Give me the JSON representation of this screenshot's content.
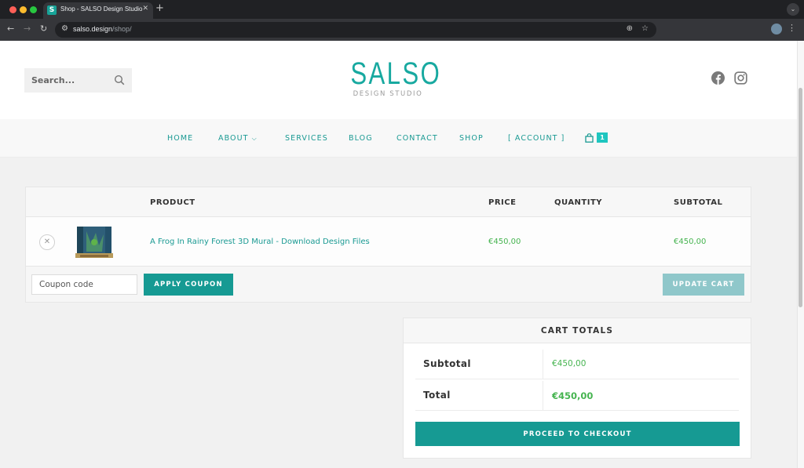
{
  "browser": {
    "tab_title": "Shop - SALSO Design Studio",
    "tab_favicon_letter": "S",
    "url_host": "salso.design",
    "url_path": "/shop/",
    "url": "salso.design/shop/"
  },
  "header": {
    "search_placeholder": "Search...",
    "logo_title": "SALSO",
    "logo_subtitle": "DESIGN STUDIO",
    "social_icons": [
      "facebook-icon",
      "instagram-icon"
    ]
  },
  "nav": {
    "items": [
      "HOME",
      "ABOUT",
      "SERVICES",
      "BLOG",
      "CONTACT",
      "SHOP",
      "[ ACCOUNT ]"
    ],
    "cart_count": "1"
  },
  "cart": {
    "columns": [
      "PRODUCT",
      "PRICE",
      "QUANTITY",
      "SUBTOTAL"
    ],
    "items": [
      {
        "name": "A Frog In Rainy Forest 3D Mural - Download Design Files",
        "price": "€450,00",
        "quantity": "",
        "subtotal": "€450,00"
      }
    ],
    "coupon_placeholder": "Coupon code",
    "apply_label": "APPLY COUPON",
    "update_label": "UPDATE CART"
  },
  "totals": {
    "title": "CART TOTALS",
    "subtotal_label": "Subtotal",
    "subtotal_value": "€450,00",
    "total_label": "Total",
    "total_value": "€450,00",
    "checkout_label": "PROCEED TO CHECKOUT"
  },
  "colors": {
    "accent": "#169a93",
    "price": "#46b450",
    "update_disabled": "#8fc7ca"
  }
}
